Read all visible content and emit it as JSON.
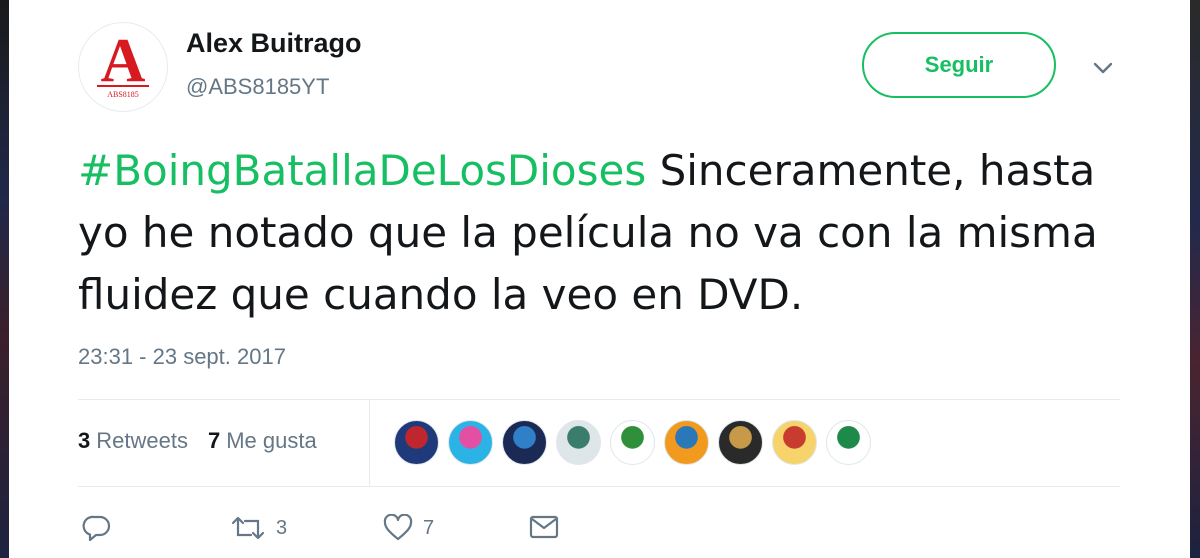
{
  "author": {
    "name": "Alex Buitrago",
    "handle": "@ABS8185YT",
    "avatar_letter": "A",
    "avatar_caption": "ABS8185"
  },
  "follow_button": {
    "label": "Seguir"
  },
  "tweet": {
    "hashtag": "#BoingBatallaDeLosDioses",
    "text": " Sinceramente, hasta yo he notado que la película no va con la misma fluidez que cuando la veo en DVD.",
    "timestamp": "23:31 - 23 sept. 2017"
  },
  "stats": {
    "retweets_count": "3",
    "retweets_label": "Retweets",
    "likes_count": "7",
    "likes_label": "Me gusta"
  },
  "likers": [
    {
      "name": "liker-1",
      "colors": [
        "#1f3a7a",
        "#c0262d"
      ]
    },
    {
      "name": "liker-2",
      "colors": [
        "#2bb3e6",
        "#e34fa3"
      ]
    },
    {
      "name": "liker-3",
      "colors": [
        "#1b2a55",
        "#2f7fc9"
      ]
    },
    {
      "name": "liker-4",
      "colors": [
        "#dfe6ea",
        "#3a7d6b"
      ]
    },
    {
      "name": "liker-5",
      "colors": [
        "#ffffff",
        "#2f8f3a"
      ]
    },
    {
      "name": "liker-6",
      "colors": [
        "#f29a1e",
        "#2a78b8"
      ]
    },
    {
      "name": "liker-7",
      "colors": [
        "#2a2a2a",
        "#c79a4a"
      ]
    },
    {
      "name": "liker-8",
      "colors": [
        "#f7d36b",
        "#c73c2f"
      ]
    },
    {
      "name": "liker-9",
      "colors": [
        "#ffffff",
        "#1d8a4a"
      ]
    }
  ],
  "actions": {
    "reply_icon": "reply-icon",
    "retweet_icon": "retweet-icon",
    "retweet_count": "3",
    "like_icon": "heart-icon",
    "like_count": "7",
    "dm_icon": "envelope-icon"
  },
  "colors": {
    "accent": "#17bf63",
    "muted": "#657786",
    "text": "#14171a",
    "border": "#e6ecf0",
    "avatar_red": "#d71920"
  }
}
